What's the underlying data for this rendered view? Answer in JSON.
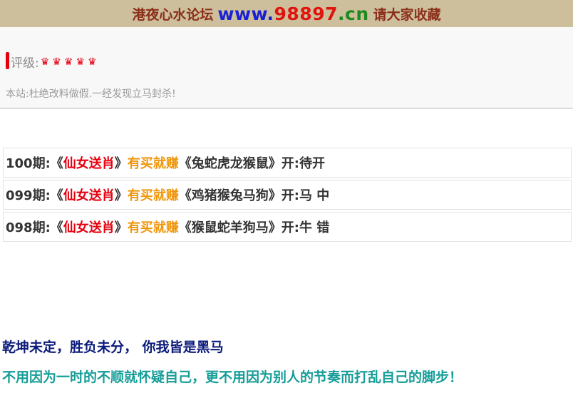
{
  "banner": {
    "left_text": "港夜心水论坛",
    "url_www": "www.",
    "url_number": "98897",
    "url_tld": ".cn",
    "right_text": "请大家收藏"
  },
  "rating": {
    "label": "评级:",
    "crowns": [
      "♛",
      "♛",
      "♛",
      "♛",
      "♛"
    ],
    "icon": "crown-icon"
  },
  "notice": "本站:杜绝改料做假.一经发现立马封杀!",
  "rows": [
    {
      "period": "100期:",
      "open_quote": "《",
      "title": "仙女送肖",
      "close_quote": "》",
      "slogan": "有买就赚",
      "picks": "《兔蛇虎龙猴鼠》",
      "result": "开:待开"
    },
    {
      "period": "099期:",
      "open_quote": "《",
      "title": "仙女送肖",
      "close_quote": "》",
      "slogan": "有买就赚",
      "picks": "《鸡猪猴兔马狗》",
      "result": "开:马 中"
    },
    {
      "period": "098期:",
      "open_quote": "《",
      "title": "仙女送肖",
      "close_quote": "》",
      "slogan": "有买就赚",
      "picks": "《猴鼠蛇羊狗马》",
      "result": "开:牛 错"
    }
  ],
  "motto1": "乾坤未定，胜负未分，  你我皆是黑马",
  "motto2": "不用因为一时的不顺就怀疑自己，更不用因为别人的节奏而打乱自己的脚步！",
  "colors": {
    "banner_bg": "#cdbf9c",
    "accent_red": "#e6000f",
    "accent_orange": "#f0960a",
    "motto1": "#0b1b7a",
    "motto2": "#169d98"
  }
}
